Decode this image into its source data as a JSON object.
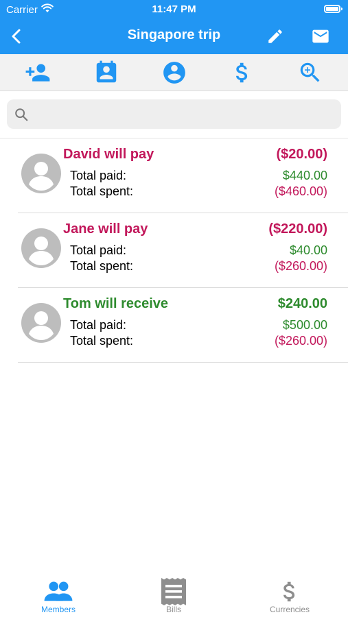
{
  "status_bar": {
    "carrier": "Carrier",
    "time": "11:47 PM"
  },
  "nav": {
    "title": "Singapore trip"
  },
  "toolbar": {
    "icons": [
      "add-member-icon",
      "calendar-contact-icon",
      "account-icon",
      "dollar-icon",
      "zoom-in-icon"
    ]
  },
  "search": {
    "value": "",
    "placeholder": ""
  },
  "members": [
    {
      "name_status": "David will pay",
      "balance": "($20.00)",
      "balance_type": "pay",
      "paid_label": "Total paid:",
      "paid": "$440.00",
      "spent_label": "Total spent:",
      "spent": "($460.00)"
    },
    {
      "name_status": "Jane will pay",
      "balance": "($220.00)",
      "balance_type": "pay",
      "paid_label": "Total paid:",
      "paid": "$40.00",
      "spent_label": "Total spent:",
      "spent": "($260.00)"
    },
    {
      "name_status": "Tom will receive",
      "balance": "$240.00",
      "balance_type": "receive",
      "paid_label": "Total paid:",
      "paid": "$500.00",
      "spent_label": "Total spent:",
      "spent": "($260.00)"
    }
  ],
  "tabs": [
    {
      "label": "Members",
      "active": true,
      "icon": "members-icon"
    },
    {
      "label": "Bills",
      "active": false,
      "icon": "bills-icon"
    },
    {
      "label": "Currencies",
      "active": false,
      "icon": "currencies-icon"
    }
  ],
  "colors": {
    "primary": "#2196f3",
    "pay": "#c2185b",
    "receive": "#2e8b2e",
    "inactive": "#8e8e8e"
  }
}
